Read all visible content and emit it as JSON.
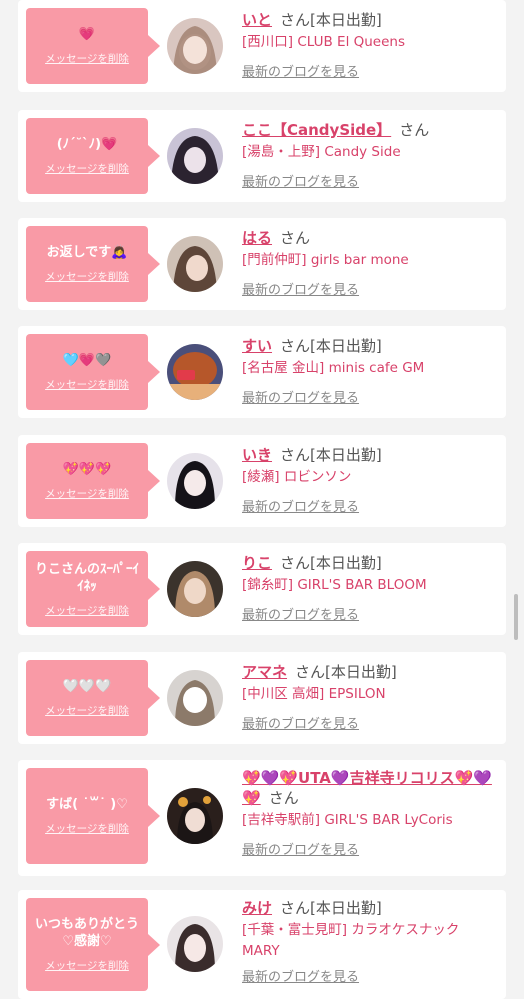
{
  "delete_label": "メッセージを削除",
  "blog_link_label": "最新のブログを見る",
  "honorific": "さん",
  "cards": [
    {
      "message": "💗",
      "name": "いと",
      "badge": "[本日出勤]",
      "shop": "[西川口] CLUB El Queens"
    },
    {
      "message": "(ﾉ´˘`ﾉ)💗",
      "name": "ここ【CandySide】",
      "badge": "",
      "shop": "[湯島・上野] Candy Side"
    },
    {
      "message": "お返しです🙇‍♀️",
      "name": "はる",
      "badge": "",
      "shop": "[門前仲町] girls bar mone"
    },
    {
      "message": "🩵💗🩶",
      "name": "すい",
      "badge": "[本日出勤]",
      "shop": "[名古屋 金山] minis cafe GM"
    },
    {
      "message": "💖💖💖",
      "name": "いき",
      "badge": "[本日出勤]",
      "shop": "[綾瀬] ロビンソン"
    },
    {
      "message": "りこさんのｽｰﾊﾟｰｲｲﾈｯ",
      "name": "りこ",
      "badge": "[本日出勤]",
      "shop": "[錦糸町] GIRL'S BAR BLOOM"
    },
    {
      "message": "🤍🤍🤍",
      "name": "アマネ",
      "badge": "[本日出勤]",
      "shop": "[中川区 高畑] EPSILON"
    },
    {
      "message": "すば( ˙꒳˙ )♡",
      "name": "💖💜💖UTA💜吉祥寺リコリス💖💜💖",
      "badge": "",
      "shop": "[吉祥寺駅前] GIRL'S BAR LyCoris"
    },
    {
      "message": "いつもありがとう♡感謝♡",
      "name": "みけ",
      "badge": "[本日出勤]",
      "shop": "[千葉・富士見町] カラオケスナック MARY"
    }
  ],
  "colors": {
    "bubble": "#f99aa6",
    "name": "#d8426a",
    "background": "#f3f3f3"
  }
}
